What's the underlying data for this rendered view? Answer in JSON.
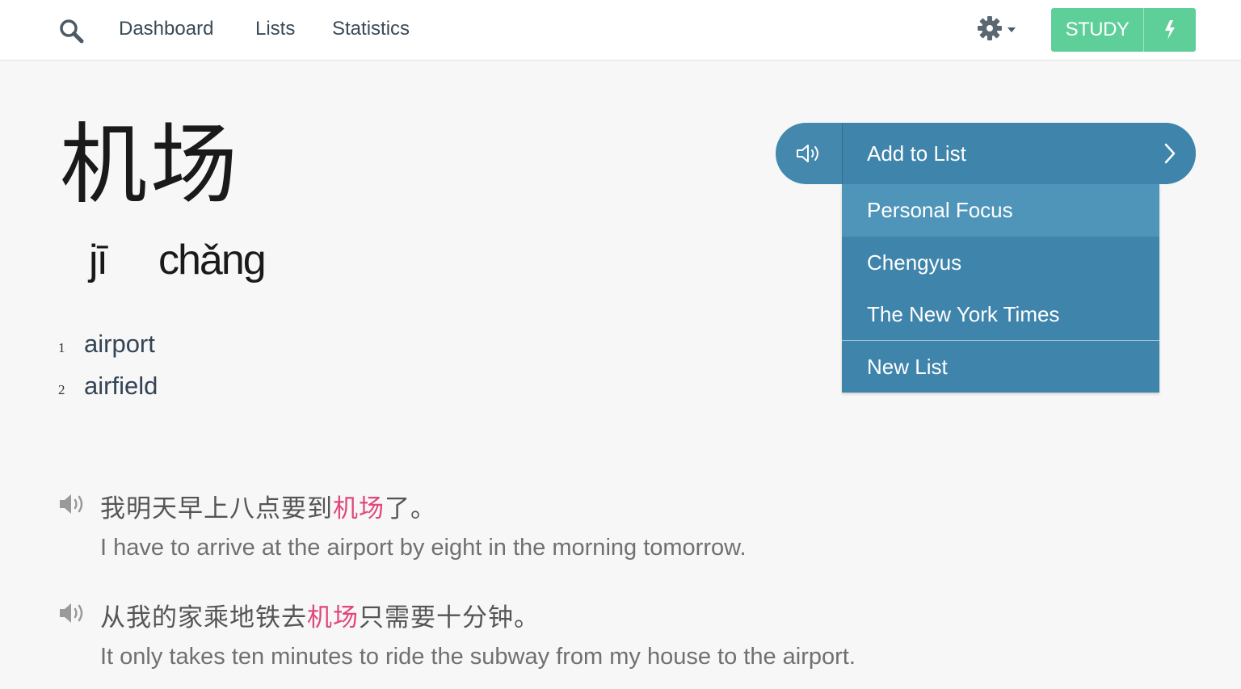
{
  "nav": {
    "links": [
      "Dashboard",
      "Lists",
      "Statistics"
    ],
    "study_label": "STUDY",
    "icons": {
      "search": "search-icon",
      "settings": "gear-icon",
      "quick_study": "lightning-icon"
    }
  },
  "word": {
    "hanzi": "机场",
    "pinyin": [
      "jī",
      "chǎng"
    ],
    "definitions": [
      {
        "num": "1",
        "text": "airport"
      },
      {
        "num": "2",
        "text": "airfield"
      }
    ]
  },
  "menu": {
    "add_to_list_label": "Add to List",
    "items": [
      "Personal Focus",
      "Chengyus",
      "The New York Times"
    ],
    "new_list_label": "New List"
  },
  "examples": [
    {
      "zh_before": "我明天早上八点要到",
      "zh_highlight": "机场",
      "zh_after": "了。",
      "en": "I have to arrive at the airport by eight in the morning tomorrow."
    },
    {
      "zh_before": "从我的家乘地铁去",
      "zh_highlight": "机场",
      "zh_after": "只需要十分钟。",
      "en": "It only takes ten minutes to ride the subway from my house to the airport."
    }
  ],
  "colors": {
    "accent_green": "#5fcf9a",
    "menu_blue": "#3f84ab",
    "highlight_pink": "#e0487a"
  }
}
